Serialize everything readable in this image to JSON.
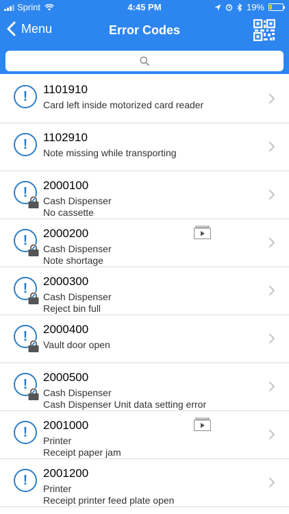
{
  "status": {
    "carrier": "Sprint",
    "time": "4:45 PM",
    "battery": "19%",
    "battery_level": 0.19
  },
  "nav": {
    "back_label": "Menu",
    "title": "Error Codes"
  },
  "search": {
    "placeholder": ""
  },
  "colors": {
    "accent": "#2d86f0",
    "icon_blue": "#2b7ec7"
  },
  "rows": [
    {
      "code": "1101910",
      "line1": "Card left inside motorized card reader",
      "line2": "",
      "locked": false,
      "video": false
    },
    {
      "code": "1102910",
      "line1": "Note missing while transporting",
      "line2": "",
      "locked": false,
      "video": false
    },
    {
      "code": "2000100",
      "line1": "Cash Dispenser",
      "line2": "No cassette",
      "locked": true,
      "video": false
    },
    {
      "code": "2000200",
      "line1": "Cash Dispenser",
      "line2": "Note shortage",
      "locked": true,
      "video": true
    },
    {
      "code": "2000300",
      "line1": "Cash Dispenser",
      "line2": "Reject bin full",
      "locked": true,
      "video": false
    },
    {
      "code": "2000400",
      "line1": "Vault door open",
      "line2": "",
      "locked": true,
      "video": false
    },
    {
      "code": "2000500",
      "line1": "Cash Dispenser",
      "line2": "Cash Dispenser Unit data setting error",
      "locked": true,
      "video": false
    },
    {
      "code": "2001000",
      "line1": "Printer",
      "line2": "Receipt paper jam",
      "locked": false,
      "video": true
    },
    {
      "code": "2001200",
      "line1": "Printer",
      "line2": "Receipt printer feed plate open",
      "locked": false,
      "video": false
    }
  ]
}
